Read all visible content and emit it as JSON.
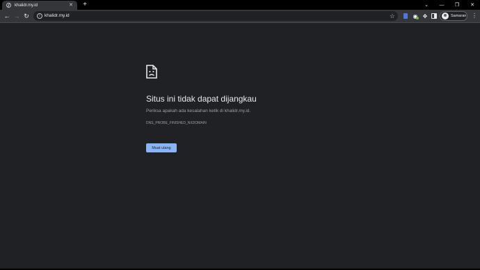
{
  "tab": {
    "title": "khalidr.my.id",
    "close": "✕"
  },
  "new_tab": "+",
  "window_controls": {
    "dropdown": "⌄",
    "minimize": "—",
    "restore": "❐",
    "close": "✕"
  },
  "toolbar": {
    "back": "←",
    "forward": "→",
    "reload": "↻",
    "menu": "⋮"
  },
  "omnibox": {
    "info": "i",
    "url": "khalidr.my.id",
    "star": "☆"
  },
  "extensions": {
    "puzzle": "✥"
  },
  "profile": {
    "label": "Samaran"
  },
  "error": {
    "icon": "sad-page-icon",
    "title": "Situs ini tidak dapat dijangkau",
    "description": "Periksa apakah ada kesalahan ketik di khalidr.my.id.",
    "code": "DNS_PROBE_FINISHED_NXDOMAIN",
    "reload_label": "Muat ulang"
  },
  "colors": {
    "background": "#202124",
    "toolbar": "#35363a",
    "tabstrip": "#000000",
    "accent": "#8ab4f8",
    "text_primary": "#e8eaed",
    "text_secondary": "#9aa0a6"
  }
}
